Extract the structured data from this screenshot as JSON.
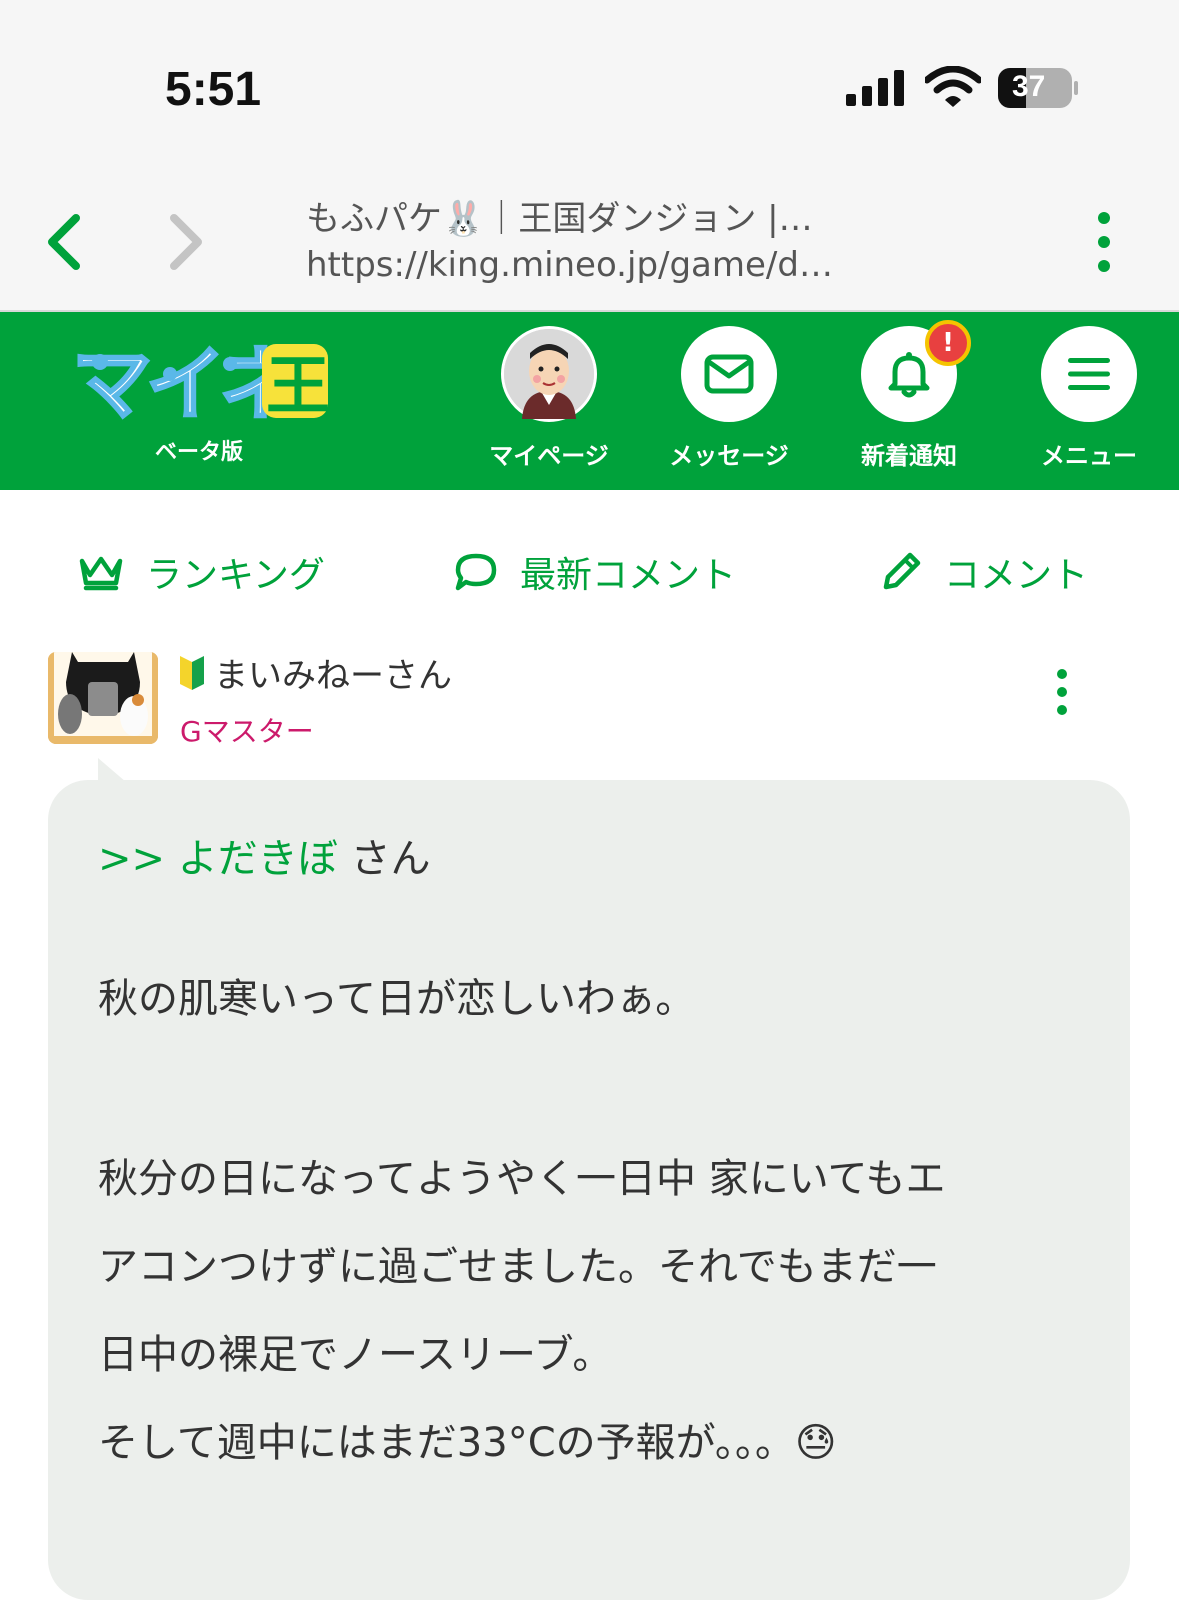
{
  "status_bar": {
    "time": "5:51",
    "battery": "37"
  },
  "browser": {
    "page_title": "もふパケ🐰｜王国ダンジョン |…",
    "url": "https://king.mineo.jp/game/d…"
  },
  "header": {
    "logo_text": "マイネ王",
    "beta_label": "ベータ版",
    "nav": [
      {
        "label": "マイページ"
      },
      {
        "label": "メッセージ"
      },
      {
        "label": "新着通知",
        "badge": "!"
      },
      {
        "label": "メニュー"
      }
    ],
    "colors": {
      "brand_green": "#00a23b",
      "badge_red": "#e84040"
    }
  },
  "subnav": {
    "ranking": "ランキング",
    "latest_comments": "最新コメント",
    "comment": "コメント"
  },
  "post": {
    "user_name": "まいみねーさん",
    "user_rank": "Gマスター",
    "reply_target": ">> よだきぼ",
    "reply_suffix": "さん",
    "lines": [
      "秋の肌寒いって日が恋しいわぁ。",
      "秋分の日になってようやく一日中 家にいてもエ",
      "アコンつけずに過ごせました。それでもまだ一",
      "日中の裸足でノースリーブ。",
      "そして週中にはまだ33°Cの予報が。。。😓"
    ]
  }
}
